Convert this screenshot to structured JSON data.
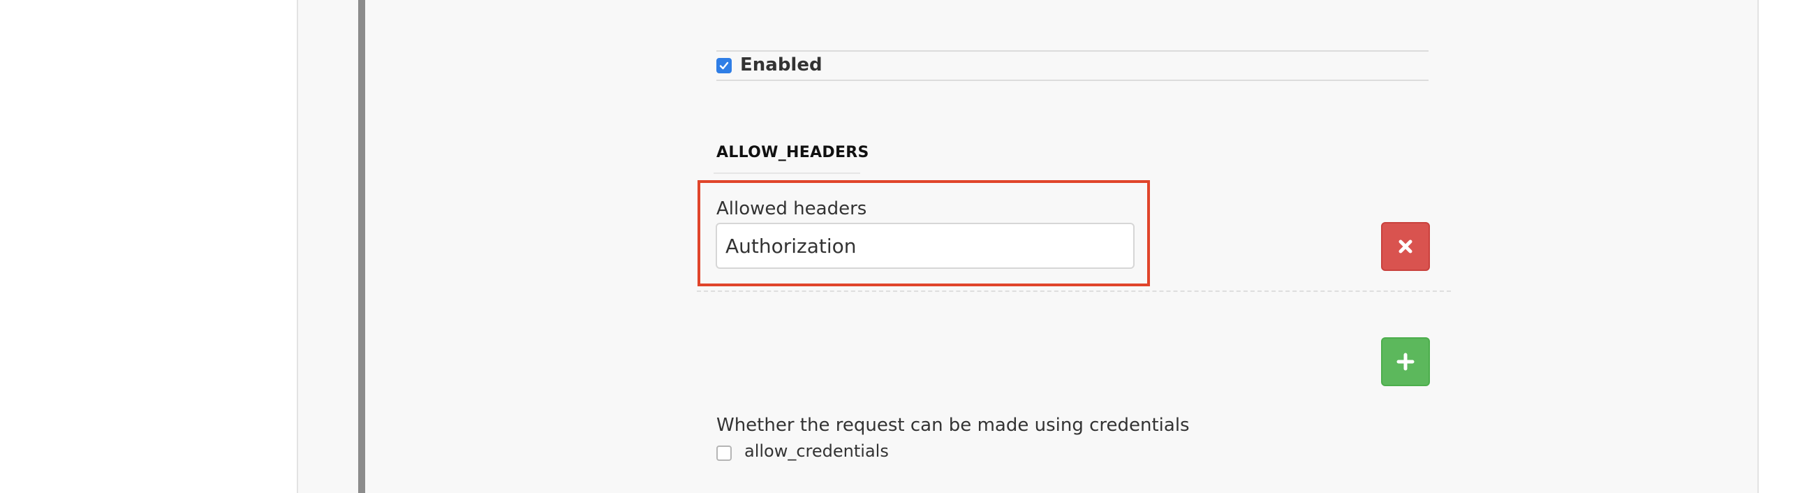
{
  "enabled": {
    "label": "Enabled",
    "checked": true
  },
  "allow_headers": {
    "section_title": "ALLOW_HEADERS",
    "field_label": "Allowed headers",
    "field_value": "Authorization",
    "remove_button_icon": "times-icon",
    "add_button_icon": "plus-icon"
  },
  "credentials": {
    "description": "Whether the request can be made using credentials",
    "option_label": "allow_credentials",
    "checked": false
  },
  "colors": {
    "highlight": "#e0452b",
    "remove_button": "#d9534f",
    "add_button": "#5cb85c",
    "checkbox_checked": "#2f7ee6"
  }
}
